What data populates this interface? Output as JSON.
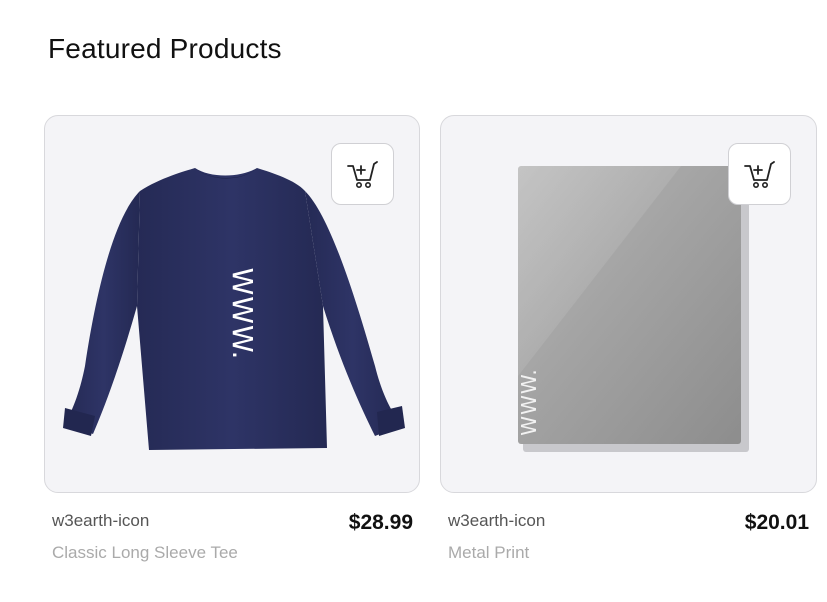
{
  "section": {
    "title": "Featured Products"
  },
  "products": [
    {
      "brand": "w3earth-icon",
      "name": "Classic Long Sleeve Tee",
      "price": "$28.99",
      "image_text": "WWW.",
      "product_color": "#2a2f5e"
    },
    {
      "brand": "w3earth-icon",
      "name": "Metal Print",
      "price": "$20.01",
      "image_text": "WWW.",
      "product_color": "#9a9a9a"
    }
  ],
  "icons": {
    "add_to_cart": "add-to-cart-icon"
  },
  "colors": {
    "card_bg": "#f4f4f7",
    "card_border": "#d8d8dc",
    "price_text": "#111111",
    "name_text": "#aaaaaa"
  }
}
